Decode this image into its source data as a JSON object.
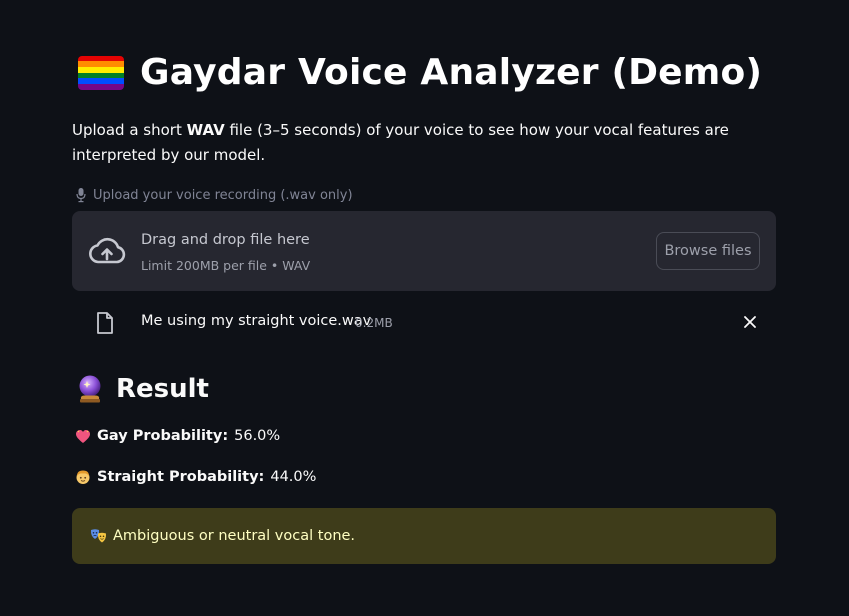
{
  "header": {
    "title": "Gaydar Voice Analyzer (Demo)",
    "flag_colors": [
      "#e40303",
      "#ff8c00",
      "#ffed00",
      "#008026",
      "#004dff",
      "#750787"
    ]
  },
  "intro": {
    "before": "Upload a short ",
    "bold": "WAV",
    "after": " file (3–5 seconds) of your voice to see how your vocal features are interpreted by our model."
  },
  "uploader": {
    "label": "Upload your voice recording (.wav only)",
    "label_icon": "microphone-icon",
    "drag_text": "Drag and drop file here",
    "limit_text": "Limit 200MB per file • WAV",
    "browse_label": "Browse files",
    "file": {
      "name": "Me using my straight voice.wav",
      "size": "0.2MB"
    }
  },
  "result": {
    "heading": "Result",
    "heading_icon": "crystal-ball-icon",
    "gay": {
      "label": "Gay Probability:",
      "value": "56.0%",
      "icon": "heart-icon"
    },
    "straight": {
      "label": "Straight Probability:",
      "value": "44.0%",
      "icon": "person-icon"
    },
    "verdict": {
      "text": "Ambiguous or neutral vocal tone.",
      "icon": "theater-masks-icon"
    }
  },
  "colors": {
    "background": "#0e1117",
    "dropzone": "#262730",
    "alert_bg": "#3e3c1a",
    "alert_text": "#ffffc2",
    "muted_text": "#808495"
  }
}
